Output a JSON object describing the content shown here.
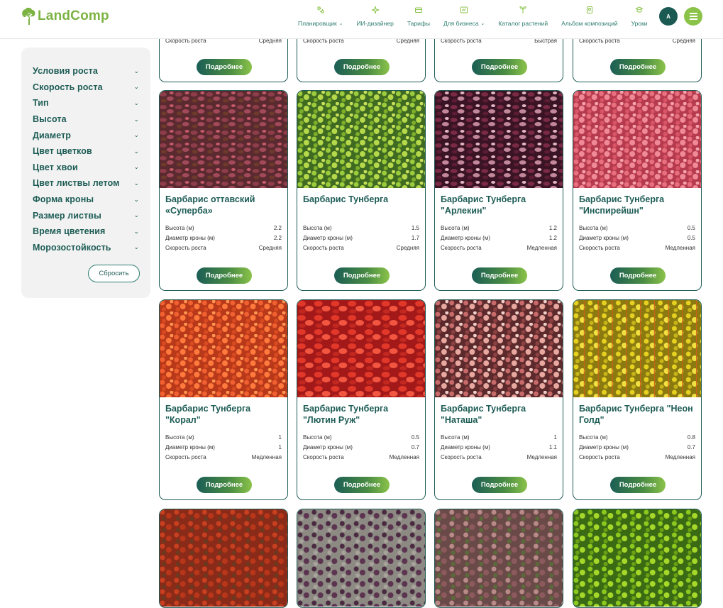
{
  "header": {
    "logo_text": "LandComp",
    "nav": [
      {
        "label": "Планировщик",
        "dropdown": true,
        "icon": "planner-icon"
      },
      {
        "label": "ИИ-дизайнер",
        "dropdown": false,
        "icon": "ai-sparkle-icon"
      },
      {
        "label": "Тарифы",
        "dropdown": false,
        "icon": "card-icon"
      },
      {
        "label": "Для бизнеса",
        "dropdown": true,
        "icon": "business-icon"
      },
      {
        "label": "Каталог растений",
        "dropdown": false,
        "icon": "plant-icon"
      },
      {
        "label": "Альбом композиций",
        "dropdown": false,
        "icon": "album-icon"
      },
      {
        "label": "Уроки",
        "dropdown": false,
        "icon": "lessons-icon"
      }
    ],
    "account_label": "А",
    "colors": {
      "primary": "#1d5c55",
      "accent": "#8bc34a"
    }
  },
  "sidebar": {
    "filters": [
      "Условия роста",
      "Скорость роста",
      "Тип",
      "Высота",
      "Диаметр",
      "Цвет цветков",
      "Цвет хвои",
      "Цвет листвы летом",
      "Форма кроны",
      "Размер листвы",
      "Время цветения",
      "Морозостойкость"
    ],
    "reset_label": "Сбросить"
  },
  "labels": {
    "height": "Высота (м)",
    "diameter": "Диаметр кроны (м)",
    "speed": "Скорость роста",
    "more": "Подробнее"
  },
  "top_row": [
    {
      "speed": "Средняя"
    },
    {
      "speed": "Средняя"
    },
    {
      "speed": "Быстрая"
    },
    {
      "speed": "Средняя"
    }
  ],
  "cards": [
    {
      "title": "Барбарис оттавский «Суперба»",
      "height": "2.2",
      "diameter": "2.2",
      "speed": "Средняя",
      "img": "p1"
    },
    {
      "title": "Барбарис Тунберга",
      "height": "1.5",
      "diameter": "1.7",
      "speed": "Средняя",
      "img": "p2"
    },
    {
      "title": "Барбарис Тунберга \"Арлекин\"",
      "height": "1.2",
      "diameter": "1.2",
      "speed": "Медленная",
      "img": "p3"
    },
    {
      "title": "Барбарис Тунберга \"Инспирейшн\"",
      "height": "0.5",
      "diameter": "0.5",
      "speed": "Медленная",
      "img": "p4"
    },
    {
      "title": "Барбарис Тунберга \"Корал\"",
      "height": "1",
      "diameter": "1",
      "speed": "Медленная",
      "img": "p5"
    },
    {
      "title": "Барбарис Тунберга \"Лютин Руж\"",
      "height": "0.5",
      "diameter": "0.7",
      "speed": "Медленная",
      "img": "p6"
    },
    {
      "title": "Барбарис Тунберга \"Наташа\"",
      "height": "1",
      "diameter": "1.1",
      "speed": "Медленная",
      "img": "p7"
    },
    {
      "title": "Барбарис Тунберга \"Неон Голд\"",
      "height": "0.8",
      "diameter": "0.7",
      "speed": "Медленная",
      "img": "p8"
    }
  ],
  "bottom_row": [
    "p9",
    "p10",
    "p11",
    "p12"
  ]
}
